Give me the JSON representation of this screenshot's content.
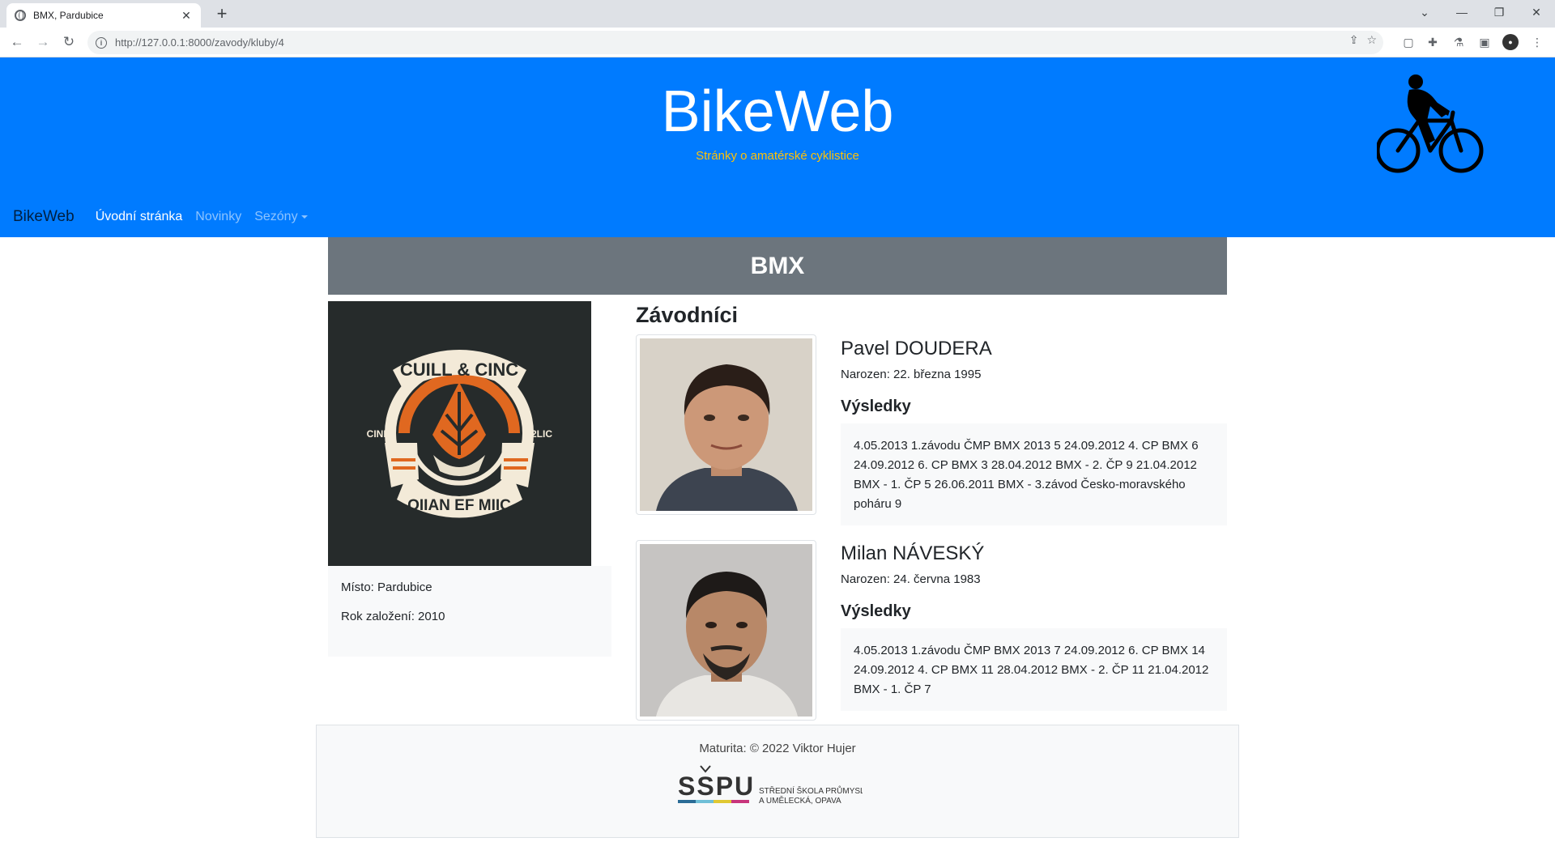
{
  "browser": {
    "tab_title": "BMX, Pardubice",
    "tab_close": "✕",
    "new_tab": "+",
    "url": "http://127.0.0.1:8000/zavody/kluby/4"
  },
  "site": {
    "title": "BikeWeb",
    "subtitle": "Stránky o amatérské cyklistice",
    "brand": "BikeWeb",
    "nav": [
      "Úvodní stránka",
      "Novinky",
      "Sezóny"
    ]
  },
  "club": {
    "name": "BMX",
    "logo_text_top": "CUILL & CINC",
    "logo_text_left": "CINE",
    "logo_text_right": "2LIC",
    "logo_text_bottom": "OIIAN EF MIIC",
    "place": "Místo: Pardubice",
    "founded": "Rok založení: 2010"
  },
  "racers_title": "Závodníci",
  "racers": [
    {
      "name": "Pavel DOUDERA",
      "born": "Narozen: 22. března 1995",
      "results_label": "Výsledky",
      "results": "4.05.2013 1.závodu ČMP BMX 2013 5 24.09.2012 4. CP BMX 6 24.09.2012 6. CP BMX 3 28.04.2012 BMX - 2. ČP 9 21.04.2012 BMX - 1. ČP 5 26.06.2011 BMX - 3.závod Česko-moravského poháru 9"
    },
    {
      "name": "Milan NÁVESKÝ",
      "born": "Narozen: 24. června 1983",
      "results_label": "Výsledky",
      "results": "4.05.2013 1.závodu ČMP BMX 2013 7 24.09.2012 6. CP BMX 14 24.09.2012 4. CP BMX 11 28.04.2012 BMX - 2. ČP 11 21.04.2012 BMX - 1. ČP 7"
    }
  ],
  "footer": {
    "credit": "Maturita: © 2022 Viktor Hujer",
    "school_abbr": "SSPU",
    "school_line1": "STŘEDNÍ ŠKOLA PRŮMYSLOVÁ",
    "school_line2": "A UMĚLECKÁ, OPAVA"
  },
  "colors": {
    "hero": "#007bff",
    "subtitle": "#ffc107",
    "section_bar": "#6c757d"
  }
}
